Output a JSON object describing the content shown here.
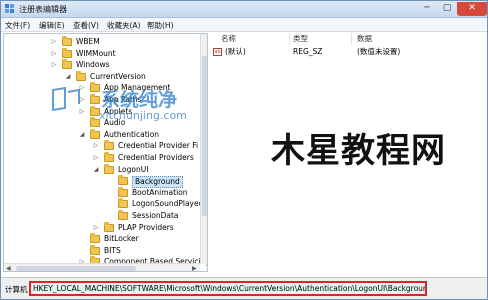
{
  "window": {
    "title": "注册表编辑器"
  },
  "menu": [
    "文件(F)",
    "编辑(E)",
    "查看(V)",
    "收藏夹(A)",
    "帮助(H)"
  ],
  "tree": [
    {
      "label": "WBEM",
      "exp": "▷"
    },
    {
      "label": "WIMMount",
      "exp": "▷"
    },
    {
      "label": "Windows",
      "exp": "▷"
    },
    {
      "label": "CurrentVersion",
      "exp": "◢"
    },
    {
      "label": "App Management",
      "exp": "▷"
    },
    {
      "label": "App Paths",
      "exp": "▷"
    },
    {
      "label": "Applets",
      "exp": "▷"
    },
    {
      "label": "Audio",
      "exp": ""
    },
    {
      "label": "Authentication",
      "exp": "◢"
    },
    {
      "label": "Credential Provider Fi",
      "exp": "▷"
    },
    {
      "label": "Credential Providers",
      "exp": "▷"
    },
    {
      "label": "LogonUI",
      "exp": "◢"
    },
    {
      "label": "Background",
      "exp": ""
    },
    {
      "label": "BootAnimation",
      "exp": ""
    },
    {
      "label": "LogonSoundPlayed",
      "exp": ""
    },
    {
      "label": "SessionData",
      "exp": ""
    },
    {
      "label": "PLAP Providers",
      "exp": "▷"
    },
    {
      "label": "BitLocker",
      "exp": ""
    },
    {
      "label": "BITS",
      "exp": ""
    },
    {
      "label": "Component Based Servicing",
      "exp": "▷"
    }
  ],
  "columns": {
    "name": "名称",
    "type": "类型",
    "data": "数据"
  },
  "values": [
    {
      "name": "(默认)",
      "type": "REG_SZ",
      "data": "(数值未设置)"
    }
  ],
  "status": {
    "label": "计算机",
    "path": "HKEY_LOCAL_MACHINE\\SOFTWARE\\Microsoft\\Windows\\CurrentVersion\\Authentication\\LogonUI\\Background"
  },
  "watermarks": {
    "site_cn": "系统纯净",
    "site_en": "xitchunjing.com",
    "big": "木星教程网"
  }
}
